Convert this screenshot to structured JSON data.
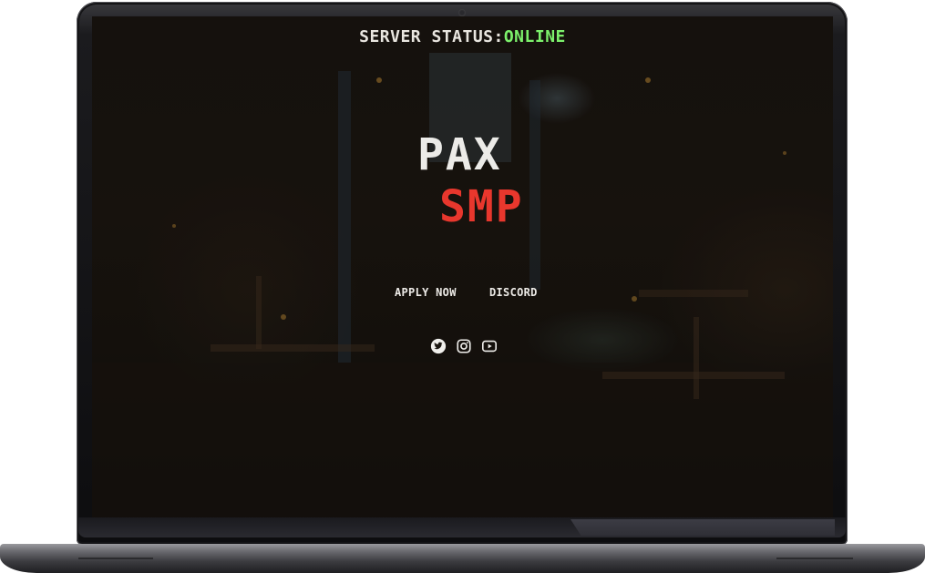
{
  "server_status": {
    "label": "SERVER STATUS:",
    "value": "ONLINE",
    "value_color": "#7cf06b"
  },
  "logo": {
    "line1": "PAX",
    "line2": "SMP",
    "line2_color": "#e8372d"
  },
  "nav": {
    "apply_label": "APPLY NOW",
    "discord_label": "DISCORD"
  },
  "socials": [
    {
      "icon": "twitter-icon"
    },
    {
      "icon": "instagram-icon"
    },
    {
      "icon": "youtube-icon"
    }
  ]
}
